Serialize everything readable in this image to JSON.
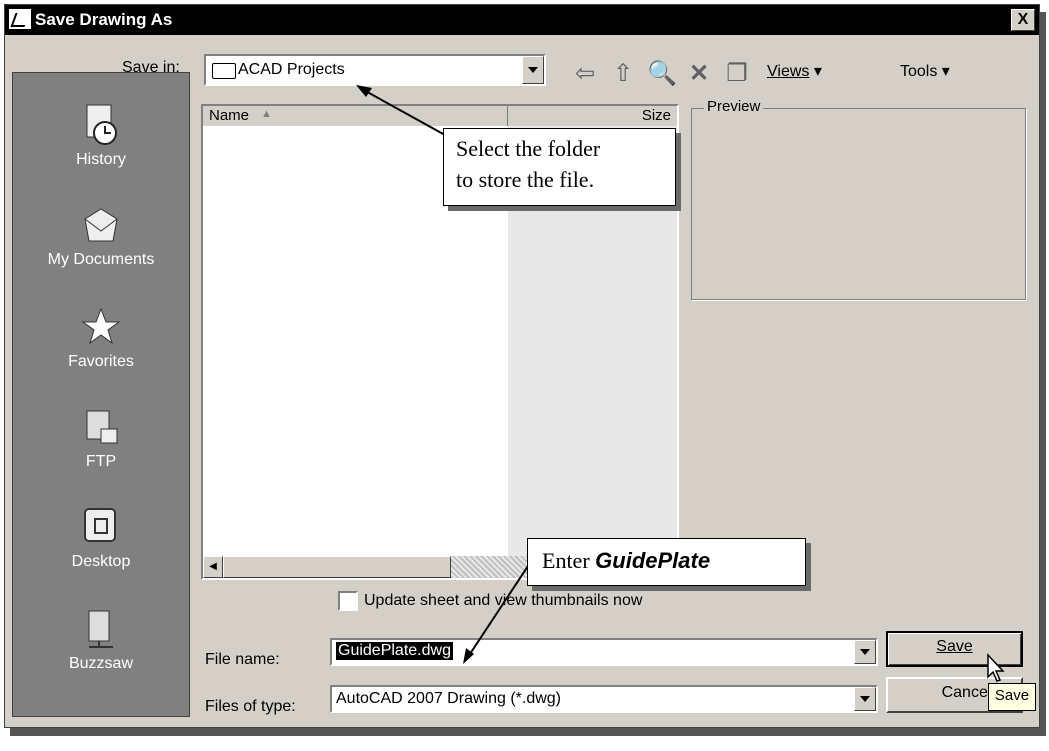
{
  "window": {
    "title": "Save Drawing As",
    "close_label": "X"
  },
  "save_in": {
    "label": "Save in:",
    "value": "ACAD Projects"
  },
  "toolbar": {
    "views_label": "Views",
    "tools_label": "Tools"
  },
  "places": [
    {
      "label": "History"
    },
    {
      "label": "My Documents"
    },
    {
      "label": "Favorites"
    },
    {
      "label": "FTP"
    },
    {
      "label": "Desktop"
    },
    {
      "label": "Buzzsaw"
    }
  ],
  "file_list": {
    "col_name": "Name",
    "col_size": "Size"
  },
  "preview": {
    "label": "Preview"
  },
  "thumbnails_checkbox": {
    "label": "Update sheet and view thumbnails now",
    "checked": false
  },
  "file_name": {
    "label": "File name:",
    "value": "GuidePlate.dwg"
  },
  "file_type": {
    "label": "Files of type:",
    "value": "AutoCAD 2007 Drawing (*.dwg)"
  },
  "buttons": {
    "save": "Save",
    "cancel": "Cancel",
    "tooltip": "Save"
  },
  "callouts": {
    "folder_line1": "Select the folder",
    "folder_line2": "to store the file.",
    "enter_prefix": "Enter ",
    "enter_name": "GuidePlate"
  }
}
